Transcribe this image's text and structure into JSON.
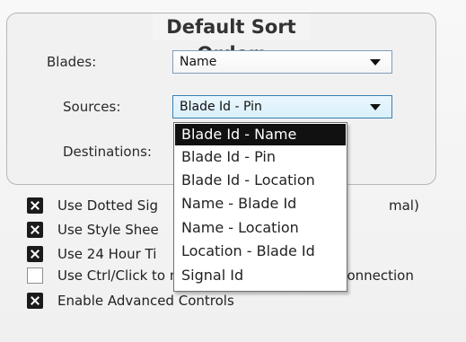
{
  "sort_order": {
    "title": "Default Sort Order:",
    "blades": {
      "label": "Blades:",
      "value": "Name"
    },
    "sources": {
      "label": "Sources:",
      "value": "Blade Id - Pin"
    },
    "destinations": {
      "label": "Destinations:"
    }
  },
  "dropdown": {
    "options": [
      "Blade Id - Name",
      "Blade Id - Pin",
      "Blade Id - Location",
      "Name - Blade Id",
      "Name - Location",
      "Location - Blade Id",
      "Signal Id"
    ],
    "highlighted_index": 0
  },
  "options": [
    {
      "label": "Use Dotted Sig",
      "tail": "mal)",
      "checked": true
    },
    {
      "label": "Use Style Shee",
      "checked": true
    },
    {
      "label": "Use 24 Hour Ti",
      "checked": true
    },
    {
      "label": "Use Ctrl/Click to make/break a crosspoint connection",
      "checked": false
    },
    {
      "label": "Enable Advanced Controls",
      "checked": true
    }
  ]
}
